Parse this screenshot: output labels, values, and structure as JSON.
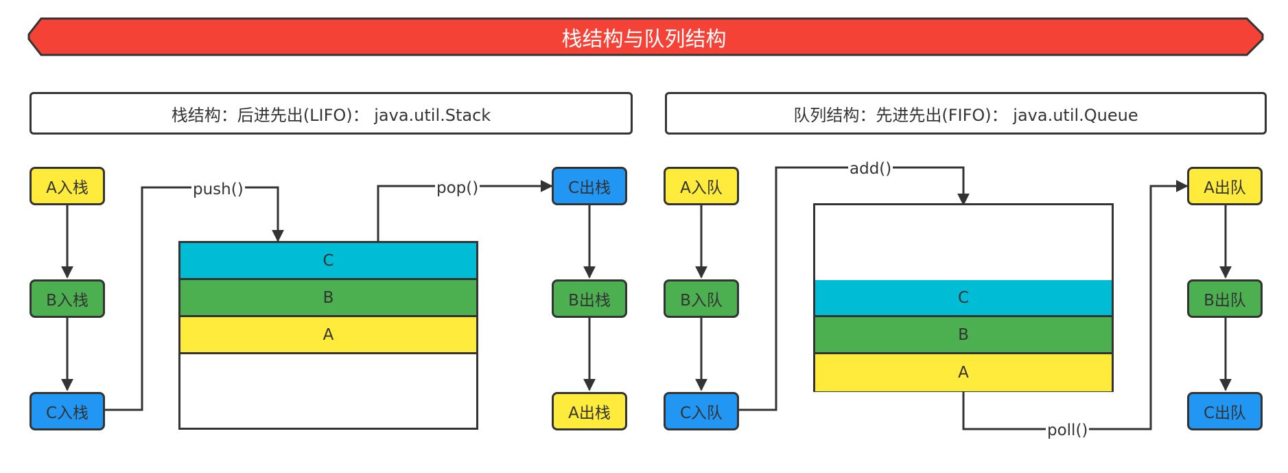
{
  "title": "栈结构与队列结构",
  "stack": {
    "caption": "栈结构：后进先出(LIFO)：  java.util.Stack",
    "push_nodes": [
      "A入栈",
      "B入栈",
      "C入栈"
    ],
    "pop_nodes": [
      "C出栈",
      "B出栈",
      "A出栈"
    ],
    "layers": [
      "C",
      "B",
      "A"
    ],
    "push_label": "push()",
    "pop_label": "pop()"
  },
  "queue": {
    "caption": "队列结构：先进先出(FIFO)：  java.util.Queue",
    "enqueue_nodes": [
      "A入队",
      "B入队",
      "C入队"
    ],
    "dequeue_nodes": [
      "A出队",
      "B出队",
      "C出队"
    ],
    "layers": [
      "C",
      "B",
      "A"
    ],
    "add_label": "add()",
    "poll_label": "poll()"
  },
  "colors": {
    "banner": "#f44336",
    "yellow": "#ffeb3b",
    "green": "#4caf50",
    "blue": "#2196f3",
    "cyan": "#00bcd4",
    "line": "#333333"
  }
}
